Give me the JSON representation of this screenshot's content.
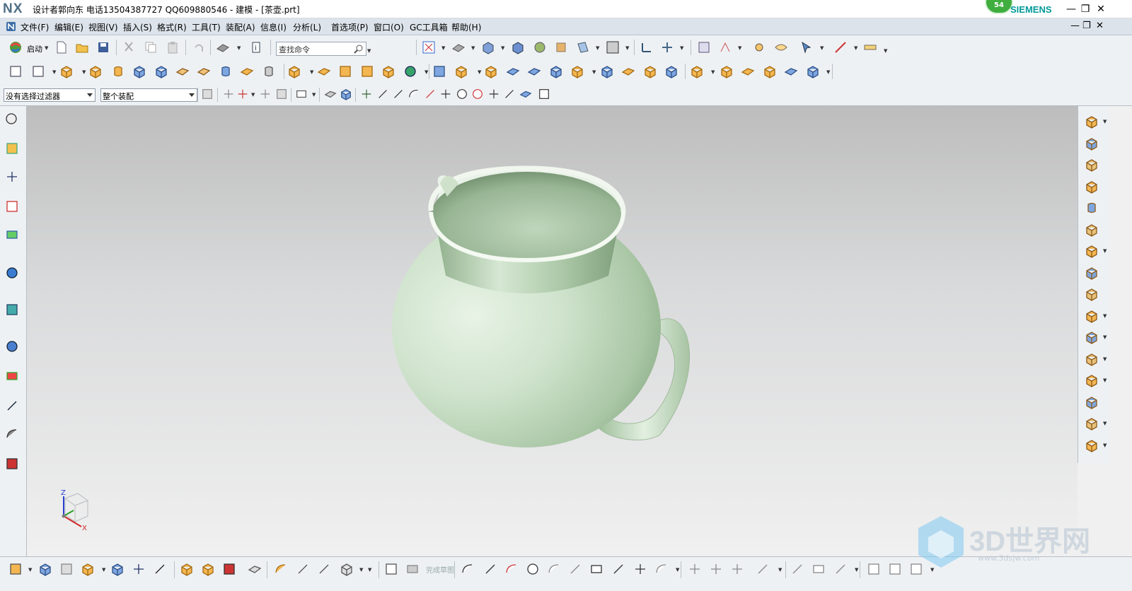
{
  "titlebar": {
    "logo": "NX",
    "title": "设计者郭向东  电话13504387727  QQ609880546 - 建模 - [茶壶.prt]",
    "brand": "SIEMENS",
    "badge_count": "54",
    "minimize": "—",
    "restore": "❐",
    "close": "✕"
  },
  "menubar": {
    "items": [
      "文件(F)",
      "编辑(E)",
      "视图(V)",
      "插入(S)",
      "格式(R)",
      "工具(T)",
      "装配(A)",
      "信息(I)",
      "分析(L)",
      "首选项(P)",
      "窗口(O)",
      "GC工具箱",
      "帮助(H)"
    ],
    "doc_minimize": "—",
    "doc_restore": "❐",
    "doc_close": "✕"
  },
  "toolbar_standard": {
    "start_label": "启动",
    "search_placeholder": "查找命令"
  },
  "selection_bar": {
    "filter_value": "没有选择过滤器",
    "scope_value": "整个装配"
  },
  "sketch_toolbar": {
    "finish_sketch_label": "完成草图"
  },
  "view_triad": {
    "z_label": "Z",
    "x_label": "X"
  },
  "watermark": {
    "text": "3D世界网",
    "url": "www.3dsjw.com"
  },
  "colors": {
    "model": "#cfe3cc",
    "viewport_top": "#bdbdbd",
    "viewport_bottom": "#f0f0f0",
    "menubar": "#dce3ea",
    "toolbar": "#eef1f4"
  }
}
